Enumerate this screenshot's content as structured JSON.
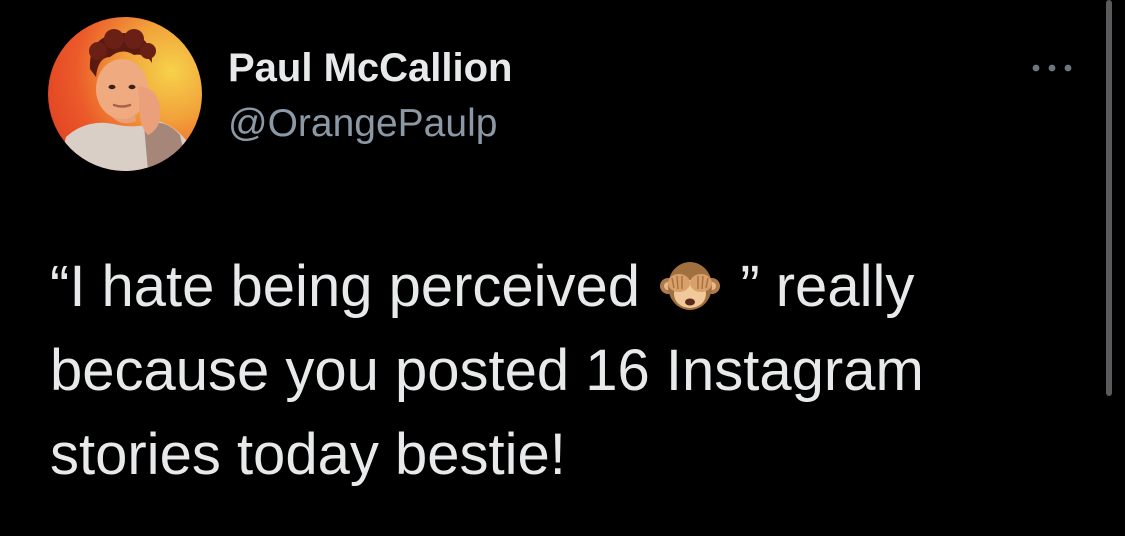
{
  "author": {
    "display_name": "Paul McCallion",
    "handle": "@OrangePaulp",
    "avatar_icon": "profile-photo"
  },
  "tweet": {
    "line1_before_emoji": "“I hate being perceived",
    "emoji_icon": "see-no-evil-monkey-icon",
    "line1_after_emoji": "” really",
    "line2": "because you posted 16 Instagram",
    "line3": "stories today bestie!"
  },
  "menu": {
    "icon": "more-options-icon"
  },
  "colors": {
    "background": "#000000",
    "text_primary": "#e7e9ea",
    "text_secondary": "#8b98a5",
    "avatar_gradient_light": "#f6d24a",
    "avatar_gradient_dark": "#d9361f"
  }
}
